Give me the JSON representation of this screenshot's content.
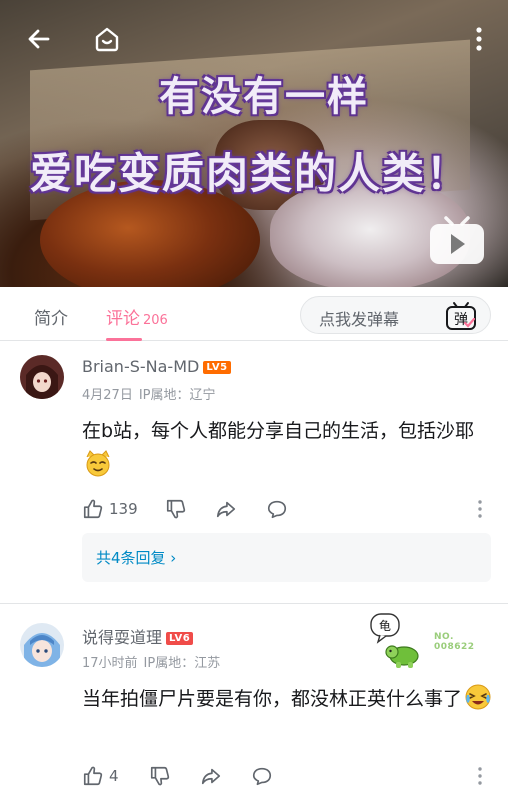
{
  "video": {
    "overlay_line1": "有没有一样",
    "overlay_line2": "爱吃变质肉类的人类！"
  },
  "tabs": {
    "intro": "简介",
    "comments": "评论",
    "comments_count": "206",
    "danmaku_placeholder": "点我发弹幕",
    "danmaku_icon_char": "弹"
  },
  "comments": [
    {
      "username": "Brian-S-Na-MD",
      "level": "LV5",
      "date": "4月27日",
      "ip": "IP属地：辽宁",
      "text": "在b站，每个人都能分享自己的生活，包括沙耶",
      "likes": "139",
      "replies_label": "共4条回复 ›"
    },
    {
      "username": "说得耍道理",
      "level": "LV6",
      "date": "17小时前",
      "ip": "IP属地：江苏",
      "text": "当年拍僵尸片要是有你，都没林正英什么事了",
      "likes": "4",
      "badge_bubble": "龟",
      "badge_no_label": "NO.",
      "badge_no": "008622"
    }
  ],
  "colors": {
    "accent": "#fb7299",
    "link": "#008ac5",
    "lv5": "#ff6c00",
    "lv6": "#f04c49"
  }
}
